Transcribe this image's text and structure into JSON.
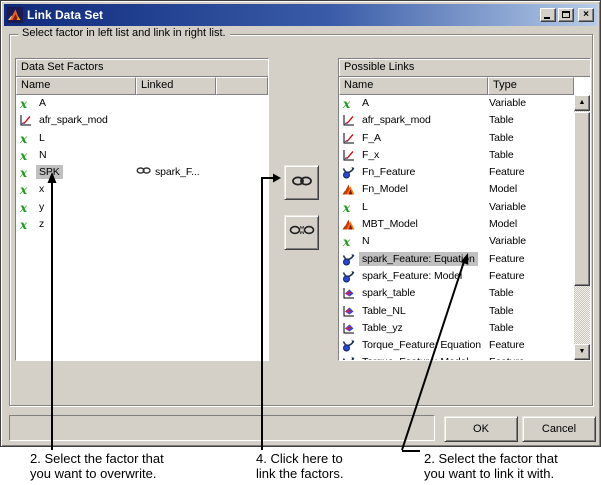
{
  "window": {
    "title": "Link Data Set",
    "icons": {
      "close_glyph": "×"
    }
  },
  "groupbox": {
    "label": "Select factor in left list and link in right list."
  },
  "left_panel": {
    "title": "Data Set Factors",
    "columns": [
      "Name",
      "Linked",
      ""
    ],
    "rows": [
      {
        "icon": "variable",
        "name": "A",
        "linked": ""
      },
      {
        "icon": "table",
        "name": "afr_spark_mod",
        "linked": ""
      },
      {
        "icon": "variable",
        "name": "L",
        "linked": ""
      },
      {
        "icon": "variable",
        "name": "N",
        "linked": ""
      },
      {
        "icon": "variable",
        "name": "SPK",
        "linked": "spark_F...",
        "linked_icon": "chain",
        "selected": true
      },
      {
        "icon": "variable",
        "name": "x",
        "linked": ""
      },
      {
        "icon": "variable",
        "name": "y",
        "linked": ""
      },
      {
        "icon": "variable",
        "name": "z",
        "linked": ""
      }
    ]
  },
  "right_panel": {
    "title": "Possible Links",
    "columns": [
      "Name",
      "Type"
    ],
    "rows": [
      {
        "icon": "variable",
        "name": "A",
        "type": "Variable"
      },
      {
        "icon": "table",
        "name": "afr_spark_mod",
        "type": "Table"
      },
      {
        "icon": "table",
        "name": "F_A",
        "type": "Table"
      },
      {
        "icon": "table",
        "name": "F_x",
        "type": "Table"
      },
      {
        "icon": "feature",
        "name": "Fn_Feature",
        "type": "Feature"
      },
      {
        "icon": "model",
        "name": "Fn_Model",
        "type": "Model"
      },
      {
        "icon": "variable",
        "name": "L",
        "type": "Variable"
      },
      {
        "icon": "model",
        "name": "MBT_Model",
        "type": "Model"
      },
      {
        "icon": "variable",
        "name": "N",
        "type": "Variable"
      },
      {
        "icon": "feature",
        "name": "spark_Feature: Equation",
        "type": "Feature",
        "selected": true
      },
      {
        "icon": "feature",
        "name": "spark_Feature: Model",
        "type": "Feature"
      },
      {
        "icon": "surface",
        "name": "spark_table",
        "type": "Table"
      },
      {
        "icon": "surface",
        "name": "Table_NL",
        "type": "Table"
      },
      {
        "icon": "surface",
        "name": "Table_yz",
        "type": "Table"
      },
      {
        "icon": "feature",
        "name": "Torque_Feature: Equation",
        "type": "Feature"
      },
      {
        "icon": "feature",
        "name": "Torque_Feature: Model",
        "type": "Feature"
      }
    ]
  },
  "middle_buttons": [
    {
      "icon": "chain-link"
    },
    {
      "icon": "chain-unlink"
    }
  ],
  "footer": {
    "ok_label": "OK",
    "cancel_label": "Cancel"
  },
  "annotations": [
    {
      "lines": [
        "2. Select the factor that",
        "you want to overwrite."
      ]
    },
    {
      "lines": [
        "4. Click here to",
        "link the factors."
      ]
    },
    {
      "lines": [
        "2. Select the factor that",
        "you want to link it with."
      ]
    }
  ],
  "colors": {
    "dialog_bg": "#d4d0c8",
    "titlebar_left": "#0f2a7c",
    "titlebar_right": "#b6cce8",
    "selection_bg": "#c0c0c0",
    "list_bg": "#ffffff",
    "variable_green": "#1e9e1e"
  }
}
